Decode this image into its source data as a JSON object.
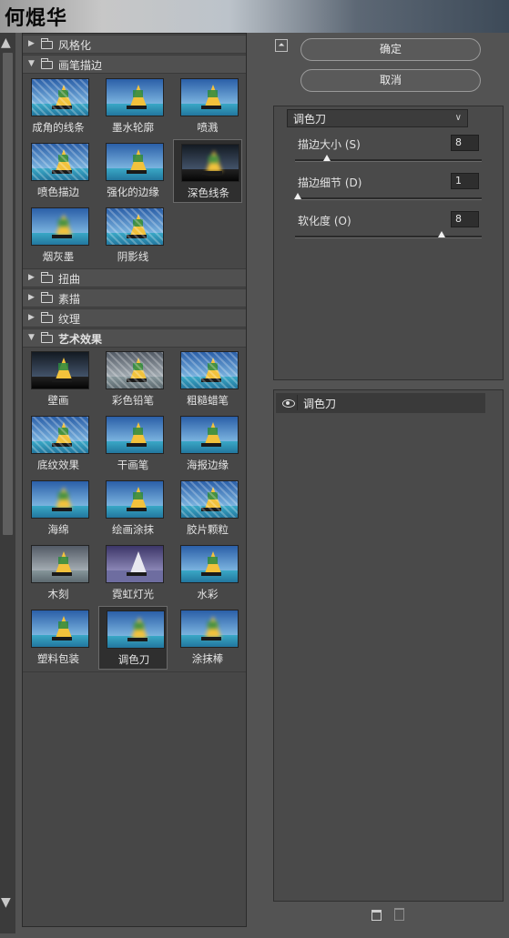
{
  "watermark": "何焜华",
  "scrollbar": {
    "up_icon": "▲",
    "down_icon": "▼"
  },
  "categories": {
    "stylize": "风格化",
    "brush": "画笔描边",
    "distort": "扭曲",
    "sketch": "素描",
    "texture": "纹理",
    "artistic": "艺术效果"
  },
  "brush_filters": [
    "成角的线条",
    "墨水轮廓",
    "喷溅",
    "喷色描边",
    "强化的边缘",
    "深色线条",
    "烟灰墨",
    "阴影线"
  ],
  "artistic_filters": [
    "壁画",
    "彩色铅笔",
    "粗糙蜡笔",
    "底纹效果",
    "干画笔",
    "海报边缘",
    "海绵",
    "绘画涂抹",
    "胶片颗粒",
    "木刻",
    "霓虹灯光",
    "水彩",
    "塑料包装",
    "调色刀",
    "涂抹棒"
  ],
  "selected_filter": "调色刀",
  "buttons": {
    "ok": "确定",
    "cancel": "取消"
  },
  "settings": {
    "filter_select": "调色刀",
    "params": [
      {
        "label": "描边大小 (S)",
        "value": "8",
        "fraction": 0.16
      },
      {
        "label": "描边细节 (D)",
        "value": "1",
        "fraction": 0.0
      },
      {
        "label": "软化度 (O)",
        "value": "8",
        "fraction": 0.8
      }
    ]
  },
  "layers": {
    "items": [
      "调色刀"
    ]
  },
  "icons": {
    "collapse": "collapse-icon",
    "eye": "eye-icon",
    "new_layer": "new-layer-icon",
    "delete": "trash-icon",
    "folder": "folder-icon"
  }
}
